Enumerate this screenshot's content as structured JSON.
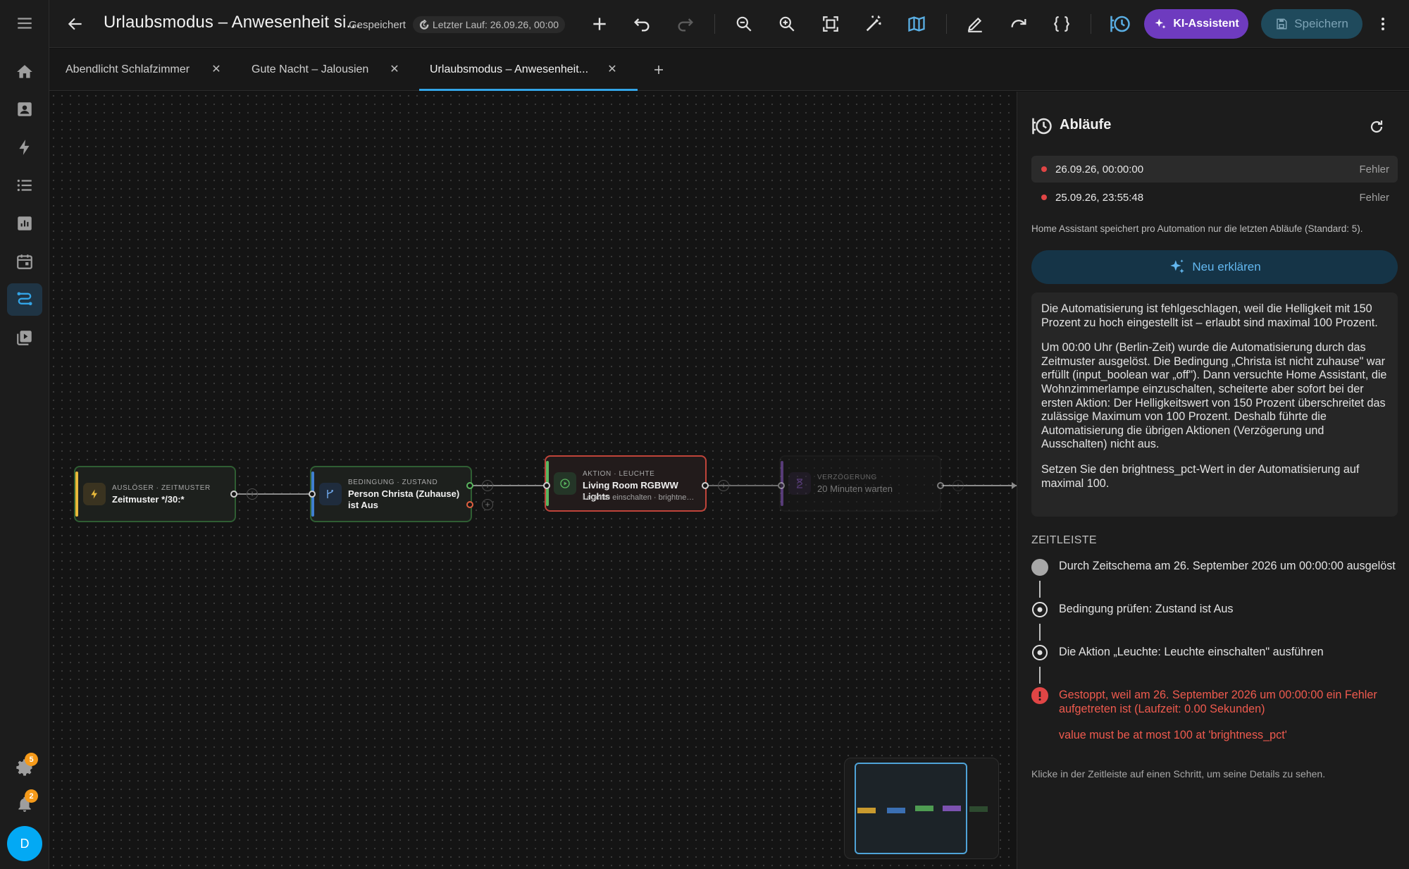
{
  "toolbar": {
    "title": "Urlaubsmodus – Anwesenheit si...",
    "saved": "Gespeichert",
    "last_run": "Letzter Lauf: 26.09.26, 00:00",
    "ai_label": "KI-Assistent",
    "save_label": "Speichern"
  },
  "tabs": [
    {
      "label": "Abendlicht Schlafzimmer"
    },
    {
      "label": "Gute Nacht – Jalousien"
    },
    {
      "label": "Urlaubsmodus – Anwesenheit..."
    }
  ],
  "rail": {
    "settings_badge": "5",
    "notifications_badge": "2",
    "avatar_initial": "D"
  },
  "flow": {
    "trigger": {
      "kind": "Auslöser · Zeitmuster",
      "label": "Zeitmuster */30:*"
    },
    "condition": {
      "kind": "Bedingung · Zustand",
      "label": "Person Christa (Zuhause) ist Aus"
    },
    "action": {
      "kind": "Aktion · Leuchte",
      "label": "Living Room RGBWW Lights",
      "sub": "Leuchte einschalten · brightness..."
    },
    "delay": {
      "kind": "Verzögerung",
      "label": "20 Minuten warten"
    }
  },
  "panel": {
    "title": "Abläufe",
    "runs": [
      {
        "time": "26.09.26, 00:00:00",
        "status": "Fehler"
      },
      {
        "time": "25.09.26, 23:55:48",
        "status": "Fehler"
      }
    ],
    "note": "Home Assistant speichert pro Automation nur die letzten Abläufe (Standard: 5).",
    "explain_button": "Neu erklären",
    "explanation": [
      "Die Automatisierung ist fehlgeschlagen, weil die Helligkeit mit 150 Prozent zu hoch eingestellt ist – erlaubt sind maximal 100 Prozent.",
      "Um 00:00 Uhr (Berlin-Zeit) wurde die Automatisierung durch das Zeitmuster ausgelöst. Die Bedingung „Christa ist nicht zuhause\" war erfüllt (input_boolean war „off\"). Dann versuchte Home Assistant, die Wohnzimmerlampe einzuschalten, scheiterte aber sofort bei der ersten Aktion: Der Helligkeitswert von 150 Prozent überschreitet das zulässige Maximum von 100 Prozent. Deshalb führte die Automatisierung die übrigen Aktionen (Verzögerung und Ausschalten) nicht aus.",
      "Setzen Sie den brightness_pct-Wert in der Automatisierung auf maximal 100."
    ],
    "timeline_heading": "ZEITLEISTE",
    "timeline": [
      "Durch Zeitschema am 26. September 2026 um 00:00:00 ausgelöst",
      "Bedingung prüfen: Zustand ist Aus",
      "Die Aktion „Leuchte: Leuchte einschalten\" ausführen",
      "Gestoppt, weil am 26. September 2026 um 00:00:00 ein Fehler aufgetreten ist (Laufzeit: 0.00 Sekunden)"
    ],
    "error_detail": "value must be at most 100 at 'brightness_pct'",
    "hint": "Klicke in der Zeitleiste auf einen Schritt, um seine Details zu sehen."
  },
  "colors": {
    "accent": "#33a4e6",
    "error": "#e04545",
    "ai": "#6e3bbf",
    "trigger": "#e8b93a",
    "condition": "#3f7fd0",
    "action_ok": "#5bb65f",
    "delay": "#8e5cc8"
  }
}
